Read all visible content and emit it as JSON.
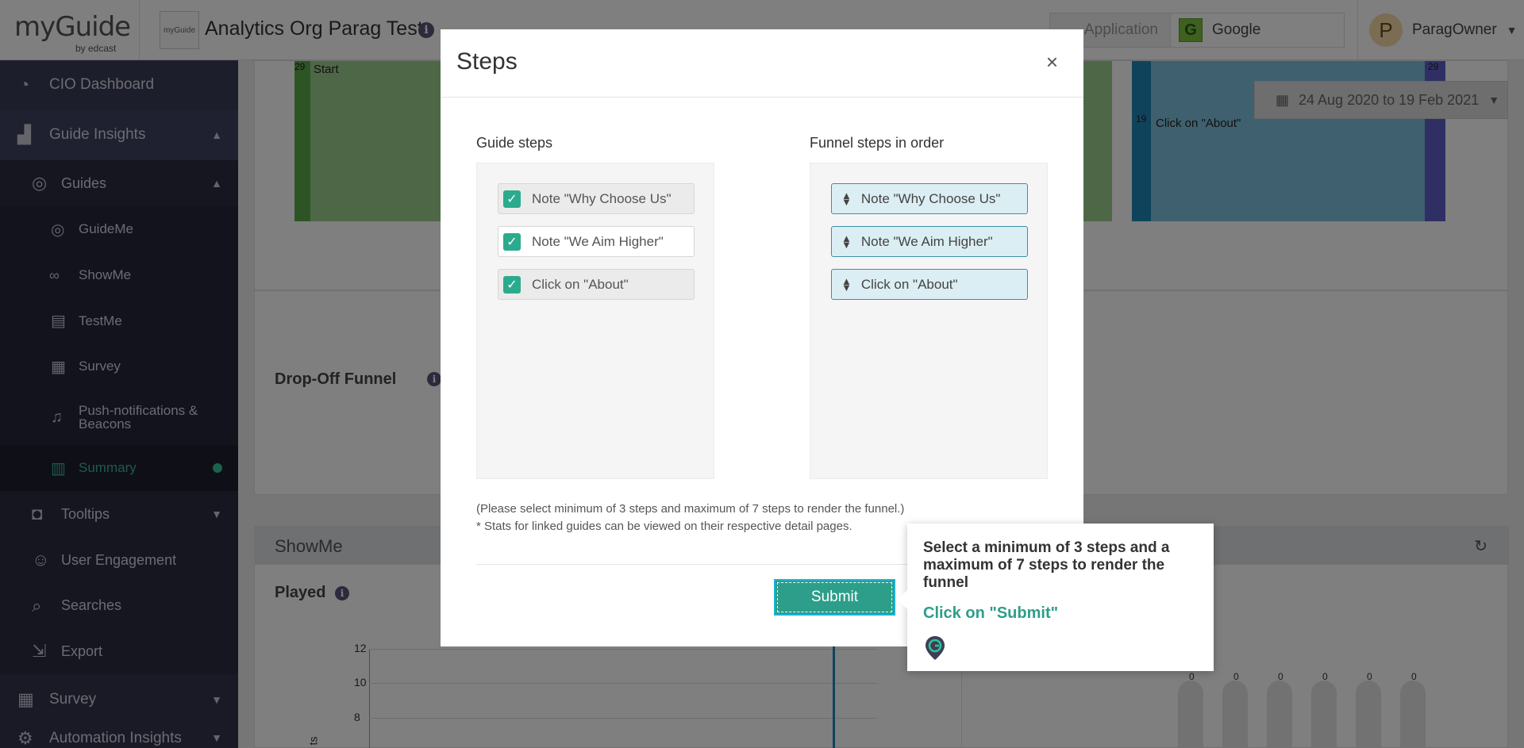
{
  "header": {
    "logo_text": "myGuide",
    "logo_by": "by edcast",
    "org_logo_text": "myGuide",
    "org_name": "Analytics Org Parag Test",
    "app_label": "Application",
    "app_value": "Google",
    "app_badge": "G",
    "user_initial": "P",
    "user_name": "ParagOwner"
  },
  "sidebar": {
    "items": [
      {
        "label": "CIO Dashboard",
        "icon": "dashboard-icon"
      },
      {
        "label": "Guide Insights",
        "icon": "chart-icon"
      },
      {
        "label": "Guides",
        "icon": "compass-icon"
      },
      {
        "label": "GuideMe",
        "icon": "compass-icon"
      },
      {
        "label": "ShowMe",
        "icon": "binoculars-icon"
      },
      {
        "label": "TestMe",
        "icon": "clipboard-icon"
      },
      {
        "label": "Survey",
        "icon": "survey-icon"
      },
      {
        "label": "Push-notifications & Beacons",
        "icon": "bell-icon"
      },
      {
        "label": "Summary",
        "icon": "summary-icon"
      },
      {
        "label": "Tooltips",
        "icon": "tooltip-icon"
      },
      {
        "label": "User Engagement",
        "icon": "user-icon"
      },
      {
        "label": "Searches",
        "icon": "search-icon"
      },
      {
        "label": "Export",
        "icon": "export-icon"
      },
      {
        "label": "Survey",
        "icon": "survey-icon"
      },
      {
        "label": "Automation Insights",
        "icon": "gear-icon"
      }
    ]
  },
  "background": {
    "date_range": "24 Aug 2020 to 19 Feb 2021",
    "funnel_start_count": "29",
    "funnel_start_label": "Start",
    "funnel_step_count": "19",
    "funnel_step_label": "Click on \"About\"",
    "funnel_end_count": "29",
    "dropoff_title": "Drop-Off Funnel",
    "showme_title": "ShowMe",
    "played_title": "Played",
    "y_ticks": [
      "12",
      "10",
      "8"
    ],
    "y_label": "ts",
    "bar_zero_labels": [
      "0",
      "0",
      "0",
      "0",
      "0",
      "0"
    ]
  },
  "modal": {
    "title": "Steps",
    "close": "×",
    "guide_steps_title": "Guide steps",
    "funnel_steps_title": "Funnel steps in order",
    "guide_steps": [
      "Note \"Why Choose Us\"",
      "Note \"We Aim Higher\"",
      "Click on \"About\""
    ],
    "funnel_steps": [
      "Note \"Why Choose Us\"",
      "Note \"We Aim Higher\"",
      "Click on \"About\""
    ],
    "note_1": "(Please select minimum of 3 steps and maximum of 7 steps to render the funnel.)",
    "note_2": "* Stats for linked guides can be viewed on their respective detail pages.",
    "submit_label": "Submit"
  },
  "tooltip": {
    "message": "Select a minimum of 3 steps and a maximum of 7 steps to render the funnel",
    "action": "Click on \"Submit\""
  }
}
